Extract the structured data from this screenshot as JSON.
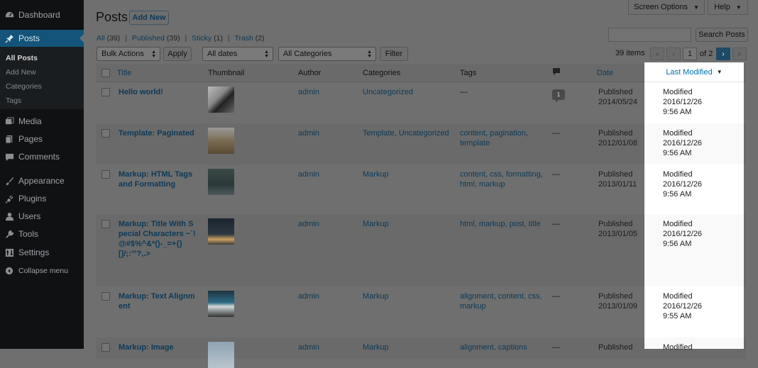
{
  "sidebar": {
    "dashboard": "Dashboard",
    "posts": "Posts",
    "sub": [
      "All Posts",
      "Add New",
      "Categories",
      "Tags"
    ],
    "media": "Media",
    "pages": "Pages",
    "comments": "Comments",
    "appearance": "Appearance",
    "plugins": "Plugins",
    "users": "Users",
    "tools": "Tools",
    "settings": "Settings",
    "collapse": "Collapse menu"
  },
  "header": {
    "title": "Posts",
    "add_new": "Add New",
    "screen_options": "Screen Options",
    "help": "Help"
  },
  "filters": {
    "all": "All",
    "all_count": "(39)",
    "published": "Published",
    "published_count": "(39)",
    "sticky": "Sticky",
    "sticky_count": "(1)",
    "trash": "Trash",
    "trash_count": "(2)",
    "sep": "|"
  },
  "search": {
    "button": "Search Posts",
    "value": ""
  },
  "actions": {
    "bulk": "Bulk Actions",
    "apply": "Apply",
    "dates": "All dates",
    "categories": "All Categories",
    "filter": "Filter"
  },
  "pagination": {
    "count": "39 items",
    "first": "«",
    "prev": "‹",
    "current": "1",
    "of": "of 2",
    "next": "›",
    "last": "»"
  },
  "table": {
    "headers": {
      "title": "Title",
      "thumbnail": "Thumbnail",
      "author": "Author",
      "categories": "Categories",
      "tags": "Tags",
      "date": "Date",
      "last_modified": "Last Modified",
      "sort_indicator": "▼"
    },
    "rows": [
      {
        "title": "Hello world!",
        "author": "admin",
        "categories": "Uncategorized",
        "tags": "—",
        "comments": "1",
        "date_status": "Published",
        "date": "2014/05/24",
        "mod_label": "Modified",
        "mod_date": "2016/12/26",
        "mod_time": "9:56 AM"
      },
      {
        "title": "Template: Paginated",
        "author": "admin",
        "categories": "Template, Uncategorized",
        "tags": "content, pagination, template",
        "comments": "—",
        "date_status": "Published",
        "date": "2012/01/08",
        "mod_label": "Modified",
        "mod_date": "2016/12/26",
        "mod_time": "9:56 AM"
      },
      {
        "title": "Markup: HTML Tags and Formatting",
        "author": "admin",
        "categories": "Markup",
        "tags": "content, css, formatting, html, markup",
        "comments": "—",
        "date_status": "Published",
        "date": "2013/01/11",
        "mod_label": "Modified",
        "mod_date": "2016/12/26",
        "mod_time": "9:56 AM"
      },
      {
        "title": "Markup: Title With Special Characters ~`!@#$%^&*()-_=+{}[]/;:'\"?,.>",
        "author": "admin",
        "categories": "Markup",
        "tags": "html, markup, post, title",
        "comments": "—",
        "date_status": "Published",
        "date": "2013/01/05",
        "mod_label": "Modified",
        "mod_date": "2016/12/26",
        "mod_time": "9:56 AM"
      },
      {
        "title": "Markup: Text Alignment",
        "author": "admin",
        "categories": "Markup",
        "tags": "alignment, content, css, markup",
        "comments": "—",
        "date_status": "Published",
        "date": "2013/01/09",
        "mod_label": "Modified",
        "mod_date": "2016/12/26",
        "mod_time": "9:55 AM"
      },
      {
        "title": "Markup: Image",
        "author": "admin",
        "categories": "Markup",
        "tags": "alignment, captions",
        "comments": "—",
        "date_status": "Published",
        "date": "",
        "mod_label": "Modified",
        "mod_date": "",
        "mod_time": ""
      }
    ]
  },
  "colors": {
    "sidebar_bg": "#0f1113",
    "sidebar_current": "#14547a",
    "overlay": "#6f6f6f",
    "link": "#0c3a59",
    "highlight_column": "#ffffff"
  }
}
